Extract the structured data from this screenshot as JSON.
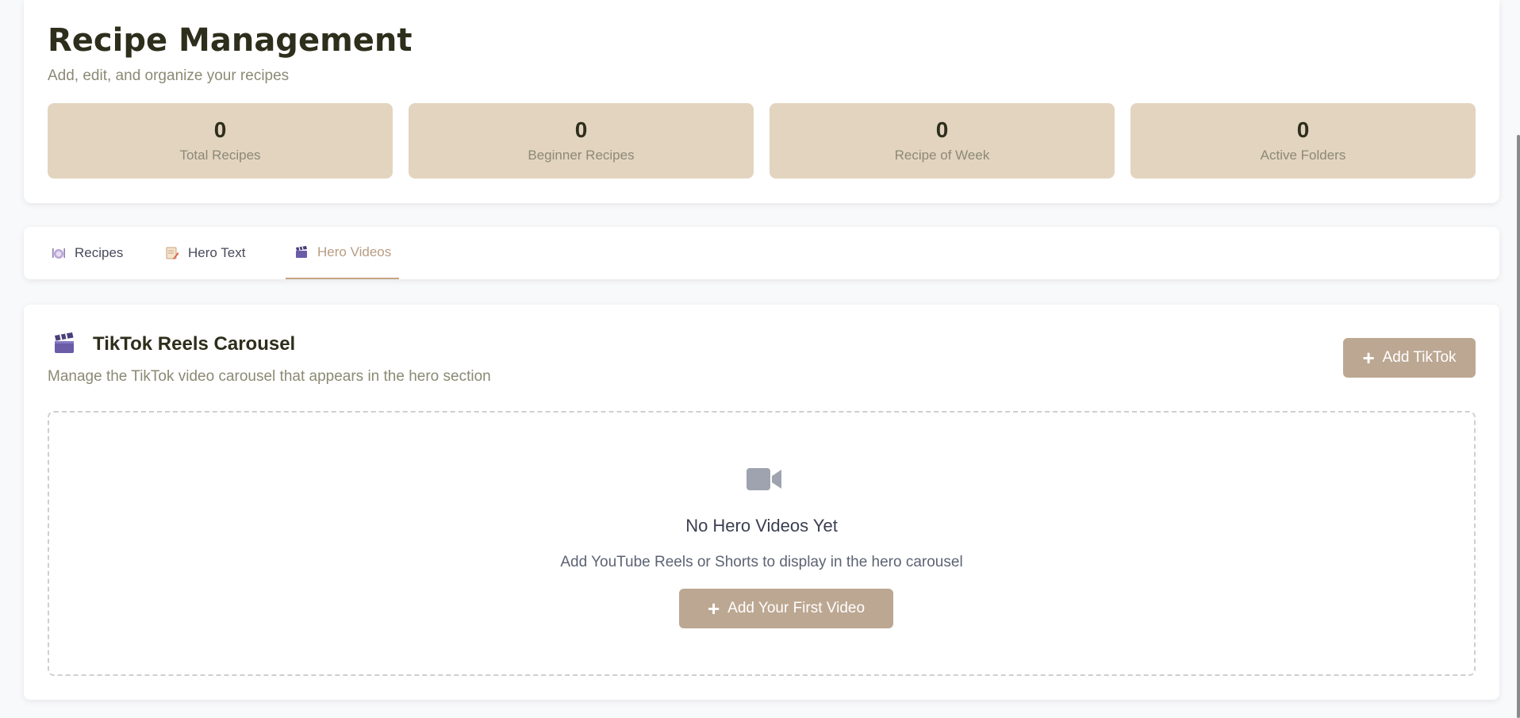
{
  "header": {
    "title": "Recipe Management",
    "subtitle": "Add, edit, and organize your recipes",
    "stats": [
      {
        "value": "0",
        "label": "Total Recipes"
      },
      {
        "value": "0",
        "label": "Beginner Recipes"
      },
      {
        "value": "0",
        "label": "Recipe of Week"
      },
      {
        "value": "0",
        "label": "Active Folders"
      }
    ]
  },
  "tabs": [
    {
      "label": "Recipes",
      "icon": "plate-icon"
    },
    {
      "label": "Hero Text",
      "icon": "memo-icon"
    },
    {
      "label": "Hero Videos",
      "icon": "clapper-icon",
      "active": true
    }
  ],
  "section": {
    "title": "TikTok Reels Carousel",
    "subtitle": "Manage the TikTok video carousel that appears in the hero section",
    "add_button_label": "Add TikTok"
  },
  "empty_state": {
    "title": "No Hero Videos Yet",
    "message": "Add YouTube Reels or Shorts to display in the hero carousel",
    "button_label": "Add Your First Video",
    "icon": "video-camera-icon"
  },
  "colors": {
    "accent": "#bca792",
    "stat_bg": "#e3d4c0",
    "active_tab": "#b89c82"
  }
}
